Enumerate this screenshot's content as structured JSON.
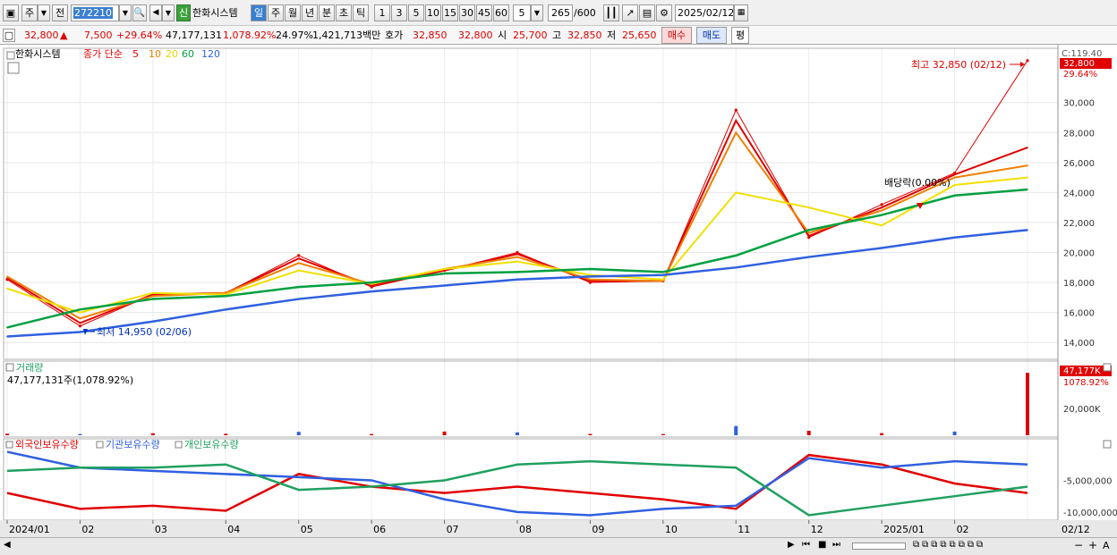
{
  "toolbar": {
    "period_type": "주",
    "nav_prev": "전",
    "code": "272210",
    "stock_name": "한화시스템",
    "credit": "신",
    "periods": [
      "일",
      "주",
      "월",
      "년",
      "분",
      "초",
      "틱"
    ],
    "active_period": "일",
    "intervals": [
      "1",
      "3",
      "5",
      "10",
      "15",
      "30",
      "45",
      "60"
    ],
    "interval_input": "5",
    "count": "265",
    "count_max": "/600",
    "date": "2025/02/12"
  },
  "info": {
    "price": "32,800",
    "arrow": "▲",
    "change": "7,500",
    "change_pct": "+29.64%",
    "volume": "47,177,131",
    "volume_pct": "1,078.92%",
    "turnover": "24.97%",
    "amount": "1,421,713백만",
    "bid_label": "호가",
    "ask": "32,850",
    "bid": "32,800",
    "open_label": "시",
    "open": "25,700",
    "high_label": "고",
    "high": "32,850",
    "low_label": "저",
    "low": "25,650",
    "buy": "매수",
    "sell": "매도",
    "avg": "평"
  },
  "legend": {
    "name": "한화시스템",
    "ma_label": "종가 단순",
    "ma": [
      "5",
      "10",
      "20",
      "60",
      "120"
    ],
    "colors": [
      "#e00000",
      "#f08000",
      "#f0e000",
      "#00a040",
      "#3060e0"
    ]
  },
  "price_panel": {
    "top_label": "C:119.40",
    "price_tag": "32,800",
    "pct_tag": "29.64%",
    "yticks": [
      "30,000",
      "28,000",
      "26,000",
      "24,000",
      "22,000",
      "20,000",
      "18,000",
      "16,000",
      "14,000"
    ],
    "high_note": "최고 32,850 (02/12)",
    "low_note": "최저 14,950 (02/06)",
    "div_note": "배당락(0.00%)"
  },
  "volume_panel": {
    "title": "거래량",
    "value": "47,177,131주(1,078.92%)",
    "tag": "47,177K",
    "tag_pct": "1078.92%",
    "ytick": "20,000K"
  },
  "holding_panel": {
    "series": [
      "외국인보유수량",
      "기관보유수량",
      "개인보유수량"
    ],
    "colors": [
      "#e00000",
      "#3060e0",
      "#20a060"
    ],
    "yticks": [
      "-5,000,000",
      "-10,000,000"
    ]
  },
  "xaxis": {
    "labels": [
      "2024/01",
      "02",
      "03",
      "04",
      "05",
      "06",
      "07",
      "08",
      "09",
      "10",
      "11",
      "12",
      "2025/01",
      "02"
    ],
    "last": "02/12"
  },
  "chart_data": {
    "type": "line",
    "title": "한화시스템",
    "x": [
      "2024/01",
      "02",
      "03",
      "04",
      "05",
      "06",
      "07",
      "08",
      "09",
      "10",
      "11",
      "12",
      "2025/01",
      "02",
      "02/12"
    ],
    "series": [
      {
        "name": "종가",
        "values": [
          18200,
          15100,
          17200,
          17300,
          19800,
          17700,
          18800,
          20000,
          18000,
          18100,
          29500,
          21000,
          23200,
          25300,
          32800
        ]
      },
      {
        "name": "5",
        "values": [
          18300,
          15300,
          17200,
          17300,
          19600,
          17800,
          18800,
          19900,
          18100,
          18100,
          28800,
          21100,
          23000,
          25200,
          27000
        ]
      },
      {
        "name": "10",
        "values": [
          18400,
          15600,
          17100,
          17300,
          19300,
          17900,
          18900,
          19700,
          18200,
          18100,
          28000,
          21300,
          22800,
          25000,
          25800
        ]
      },
      {
        "name": "20",
        "values": [
          17600,
          16000,
          17300,
          17200,
          18800,
          17900,
          18900,
          19400,
          18500,
          18200,
          24000,
          23000,
          21800,
          24500,
          25000
        ]
      },
      {
        "name": "60",
        "values": [
          15000,
          16200,
          16900,
          17100,
          17700,
          18000,
          18600,
          18700,
          18900,
          18700,
          19800,
          21500,
          22500,
          23800,
          24200
        ]
      },
      {
        "name": "120",
        "values": [
          14400,
          14700,
          15400,
          16200,
          16900,
          17400,
          17800,
          18200,
          18400,
          18500,
          19000,
          19700,
          20300,
          21000,
          21500
        ]
      }
    ],
    "ylim": [
      13000,
      33500
    ],
    "volume_k": [
      1200,
      900,
      1500,
      1100,
      2600,
      900,
      2800,
      2200,
      1000,
      900,
      7000,
      3400,
      1600,
      2800,
      47177
    ],
    "holdings": [
      {
        "name": "외국인보유수량",
        "values": [
          -7000000,
          -9500000,
          -9000000,
          -9800000,
          -4000000,
          -6000000,
          -7000000,
          -6000000,
          -7000000,
          -8000000,
          -9500000,
          -1000000,
          -2500000,
          -5500000,
          -7000000
        ]
      },
      {
        "name": "기관보유수량",
        "values": [
          -500000,
          -3000000,
          -3500000,
          -4000000,
          -4500000,
          -5000000,
          -8000000,
          -10000000,
          -10500000,
          -9500000,
          -9000000,
          -1500000,
          -3000000,
          -2000000,
          -2500000
        ]
      },
      {
        "name": "개인보유수량",
        "values": [
          -3500000,
          -3000000,
          -3000000,
          -2500000,
          -6500000,
          -6000000,
          -5000000,
          -2500000,
          -2000000,
          -2500000,
          -3000000,
          -10500000,
          -9000000,
          -7500000,
          -6000000
        ]
      }
    ]
  }
}
